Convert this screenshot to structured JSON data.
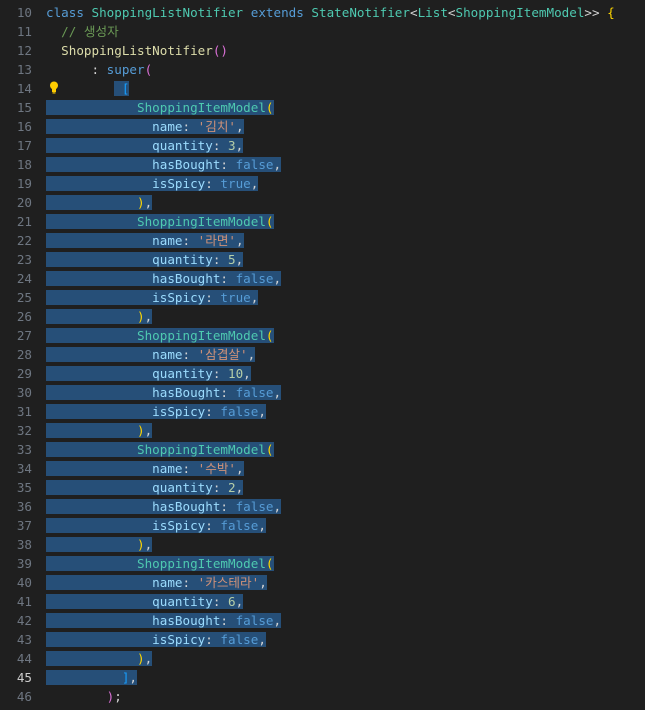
{
  "editor": {
    "language": "dart",
    "active_line": 45,
    "lines": [
      {
        "n": 10,
        "tokens": [
          [
            "kw",
            "class "
          ],
          [
            "cls",
            "ShoppingListNotifier "
          ],
          [
            "kw",
            "extends "
          ],
          [
            "cls",
            "StateNotifier"
          ],
          [
            "pn",
            "<"
          ],
          [
            "cls",
            "List"
          ],
          [
            "pn",
            "<"
          ],
          [
            "cls",
            "ShoppingItemModel"
          ],
          [
            "pn",
            ">> "
          ],
          [
            "p1",
            "{"
          ]
        ]
      },
      {
        "n": 11,
        "tokens": [
          [
            "pn",
            "  "
          ],
          [
            "cm",
            "// 생성자"
          ]
        ]
      },
      {
        "n": 12,
        "tokens": [
          [
            "pn",
            "  "
          ],
          [
            "fn",
            "ShoppingListNotifier"
          ],
          [
            "p2",
            "()"
          ]
        ]
      },
      {
        "n": 13,
        "tokens": [
          [
            "pn",
            "      : "
          ],
          [
            "kw",
            "super"
          ],
          [
            "p2",
            "("
          ]
        ]
      },
      {
        "n": 14,
        "tokens": [
          [
            "pn",
            "          "
          ],
          [
            "p3",
            "["
          ]
        ],
        "sel_from": 9
      },
      {
        "n": 15,
        "tokens": [
          [
            "pn",
            "            "
          ],
          [
            "cls",
            "ShoppingItemModel"
          ],
          [
            "p1",
            "("
          ]
        ],
        "sel_from": 0
      },
      {
        "n": 16,
        "tokens": [
          [
            "pn",
            "              "
          ],
          [
            "prop",
            "name"
          ],
          [
            "pn",
            ": "
          ],
          [
            "str",
            "'김치'"
          ],
          [
            "pn",
            ","
          ]
        ],
        "sel_from": 0
      },
      {
        "n": 17,
        "tokens": [
          [
            "pn",
            "              "
          ],
          [
            "prop",
            "quantity"
          ],
          [
            "pn",
            ": "
          ],
          [
            "num",
            "3"
          ],
          [
            "pn",
            ","
          ]
        ],
        "sel_from": 0
      },
      {
        "n": 18,
        "tokens": [
          [
            "pn",
            "              "
          ],
          [
            "prop",
            "hasBought"
          ],
          [
            "pn",
            ": "
          ],
          [
            "bool",
            "false"
          ],
          [
            "pn",
            ","
          ]
        ],
        "sel_from": 0
      },
      {
        "n": 19,
        "tokens": [
          [
            "pn",
            "              "
          ],
          [
            "prop",
            "isSpicy"
          ],
          [
            "pn",
            ": "
          ],
          [
            "bool",
            "true"
          ],
          [
            "pn",
            ","
          ]
        ],
        "sel_from": 0
      },
      {
        "n": 20,
        "tokens": [
          [
            "pn",
            "            "
          ],
          [
            "p1",
            ")"
          ],
          [
            "pn",
            ","
          ]
        ],
        "sel_from": 0
      },
      {
        "n": 21,
        "tokens": [
          [
            "pn",
            "            "
          ],
          [
            "cls",
            "ShoppingItemModel"
          ],
          [
            "p1",
            "("
          ]
        ],
        "sel_from": 0
      },
      {
        "n": 22,
        "tokens": [
          [
            "pn",
            "              "
          ],
          [
            "prop",
            "name"
          ],
          [
            "pn",
            ": "
          ],
          [
            "str",
            "'라면'"
          ],
          [
            "pn",
            ","
          ]
        ],
        "sel_from": 0
      },
      {
        "n": 23,
        "tokens": [
          [
            "pn",
            "              "
          ],
          [
            "prop",
            "quantity"
          ],
          [
            "pn",
            ": "
          ],
          [
            "num",
            "5"
          ],
          [
            "pn",
            ","
          ]
        ],
        "sel_from": 0
      },
      {
        "n": 24,
        "tokens": [
          [
            "pn",
            "              "
          ],
          [
            "prop",
            "hasBought"
          ],
          [
            "pn",
            ": "
          ],
          [
            "bool",
            "false"
          ],
          [
            "pn",
            ","
          ]
        ],
        "sel_from": 0
      },
      {
        "n": 25,
        "tokens": [
          [
            "pn",
            "              "
          ],
          [
            "prop",
            "isSpicy"
          ],
          [
            "pn",
            ": "
          ],
          [
            "bool",
            "true"
          ],
          [
            "pn",
            ","
          ]
        ],
        "sel_from": 0
      },
      {
        "n": 26,
        "tokens": [
          [
            "pn",
            "            "
          ],
          [
            "p1",
            ")"
          ],
          [
            "pn",
            ","
          ]
        ],
        "sel_from": 0
      },
      {
        "n": 27,
        "tokens": [
          [
            "pn",
            "            "
          ],
          [
            "cls",
            "ShoppingItemModel"
          ],
          [
            "p1",
            "("
          ]
        ],
        "sel_from": 0
      },
      {
        "n": 28,
        "tokens": [
          [
            "pn",
            "              "
          ],
          [
            "prop",
            "name"
          ],
          [
            "pn",
            ": "
          ],
          [
            "str",
            "'삼겹살'"
          ],
          [
            "pn",
            ","
          ]
        ],
        "sel_from": 0
      },
      {
        "n": 29,
        "tokens": [
          [
            "pn",
            "              "
          ],
          [
            "prop",
            "quantity"
          ],
          [
            "pn",
            ": "
          ],
          [
            "num",
            "10"
          ],
          [
            "pn",
            ","
          ]
        ],
        "sel_from": 0
      },
      {
        "n": 30,
        "tokens": [
          [
            "pn",
            "              "
          ],
          [
            "prop",
            "hasBought"
          ],
          [
            "pn",
            ": "
          ],
          [
            "bool",
            "false"
          ],
          [
            "pn",
            ","
          ]
        ],
        "sel_from": 0
      },
      {
        "n": 31,
        "tokens": [
          [
            "pn",
            "              "
          ],
          [
            "prop",
            "isSpicy"
          ],
          [
            "pn",
            ": "
          ],
          [
            "bool",
            "false"
          ],
          [
            "pn",
            ","
          ]
        ],
        "sel_from": 0
      },
      {
        "n": 32,
        "tokens": [
          [
            "pn",
            "            "
          ],
          [
            "p1",
            ")"
          ],
          [
            "pn",
            ","
          ]
        ],
        "sel_from": 0
      },
      {
        "n": 33,
        "tokens": [
          [
            "pn",
            "            "
          ],
          [
            "cls",
            "ShoppingItemModel"
          ],
          [
            "p1",
            "("
          ]
        ],
        "sel_from": 0
      },
      {
        "n": 34,
        "tokens": [
          [
            "pn",
            "              "
          ],
          [
            "prop",
            "name"
          ],
          [
            "pn",
            ": "
          ],
          [
            "str",
            "'수박'"
          ],
          [
            "pn",
            ","
          ]
        ],
        "sel_from": 0
      },
      {
        "n": 35,
        "tokens": [
          [
            "pn",
            "              "
          ],
          [
            "prop",
            "quantity"
          ],
          [
            "pn",
            ": "
          ],
          [
            "num",
            "2"
          ],
          [
            "pn",
            ","
          ]
        ],
        "sel_from": 0
      },
      {
        "n": 36,
        "tokens": [
          [
            "pn",
            "              "
          ],
          [
            "prop",
            "hasBought"
          ],
          [
            "pn",
            ": "
          ],
          [
            "bool",
            "false"
          ],
          [
            "pn",
            ","
          ]
        ],
        "sel_from": 0
      },
      {
        "n": 37,
        "tokens": [
          [
            "pn",
            "              "
          ],
          [
            "prop",
            "isSpicy"
          ],
          [
            "pn",
            ": "
          ],
          [
            "bool",
            "false"
          ],
          [
            "pn",
            ","
          ]
        ],
        "sel_from": 0
      },
      {
        "n": 38,
        "tokens": [
          [
            "pn",
            "            "
          ],
          [
            "p1",
            ")"
          ],
          [
            "pn",
            ","
          ]
        ],
        "sel_from": 0
      },
      {
        "n": 39,
        "tokens": [
          [
            "pn",
            "            "
          ],
          [
            "cls",
            "ShoppingItemModel"
          ],
          [
            "p1",
            "("
          ]
        ],
        "sel_from": 0
      },
      {
        "n": 40,
        "tokens": [
          [
            "pn",
            "              "
          ],
          [
            "prop",
            "name"
          ],
          [
            "pn",
            ": "
          ],
          [
            "str",
            "'카스테라'"
          ],
          [
            "pn",
            ","
          ]
        ],
        "sel_from": 0
      },
      {
        "n": 41,
        "tokens": [
          [
            "pn",
            "              "
          ],
          [
            "prop",
            "quantity"
          ],
          [
            "pn",
            ": "
          ],
          [
            "num",
            "6"
          ],
          [
            "pn",
            ","
          ]
        ],
        "sel_from": 0
      },
      {
        "n": 42,
        "tokens": [
          [
            "pn",
            "              "
          ],
          [
            "prop",
            "hasBought"
          ],
          [
            "pn",
            ": "
          ],
          [
            "bool",
            "false"
          ],
          [
            "pn",
            ","
          ]
        ],
        "sel_from": 0
      },
      {
        "n": 43,
        "tokens": [
          [
            "pn",
            "              "
          ],
          [
            "prop",
            "isSpicy"
          ],
          [
            "pn",
            ": "
          ],
          [
            "bool",
            "false"
          ],
          [
            "pn",
            ","
          ]
        ],
        "sel_from": 0
      },
      {
        "n": 44,
        "tokens": [
          [
            "pn",
            "            "
          ],
          [
            "p1",
            ")"
          ],
          [
            "pn",
            ","
          ]
        ],
        "sel_from": 0
      },
      {
        "n": 45,
        "tokens": [
          [
            "pn",
            "          "
          ],
          [
            "p3",
            "]"
          ],
          [
            "pn",
            ","
          ]
        ],
        "sel_from": 0
      },
      {
        "n": 46,
        "tokens": [
          [
            "pn",
            "        "
          ],
          [
            "p2",
            ")"
          ],
          [
            "pn",
            ";"
          ]
        ]
      }
    ]
  },
  "lightbulb_line": 14,
  "colors": {
    "background": "#1f1f1f",
    "selection": "#264f78",
    "keyword": "#569cd6",
    "class": "#4ec9b0",
    "function": "#dcdcaa",
    "comment": "#6a9955",
    "string": "#ce9178",
    "number": "#b5cea8",
    "property": "#9cdcfe",
    "lightbulb": "#ffcc00"
  }
}
